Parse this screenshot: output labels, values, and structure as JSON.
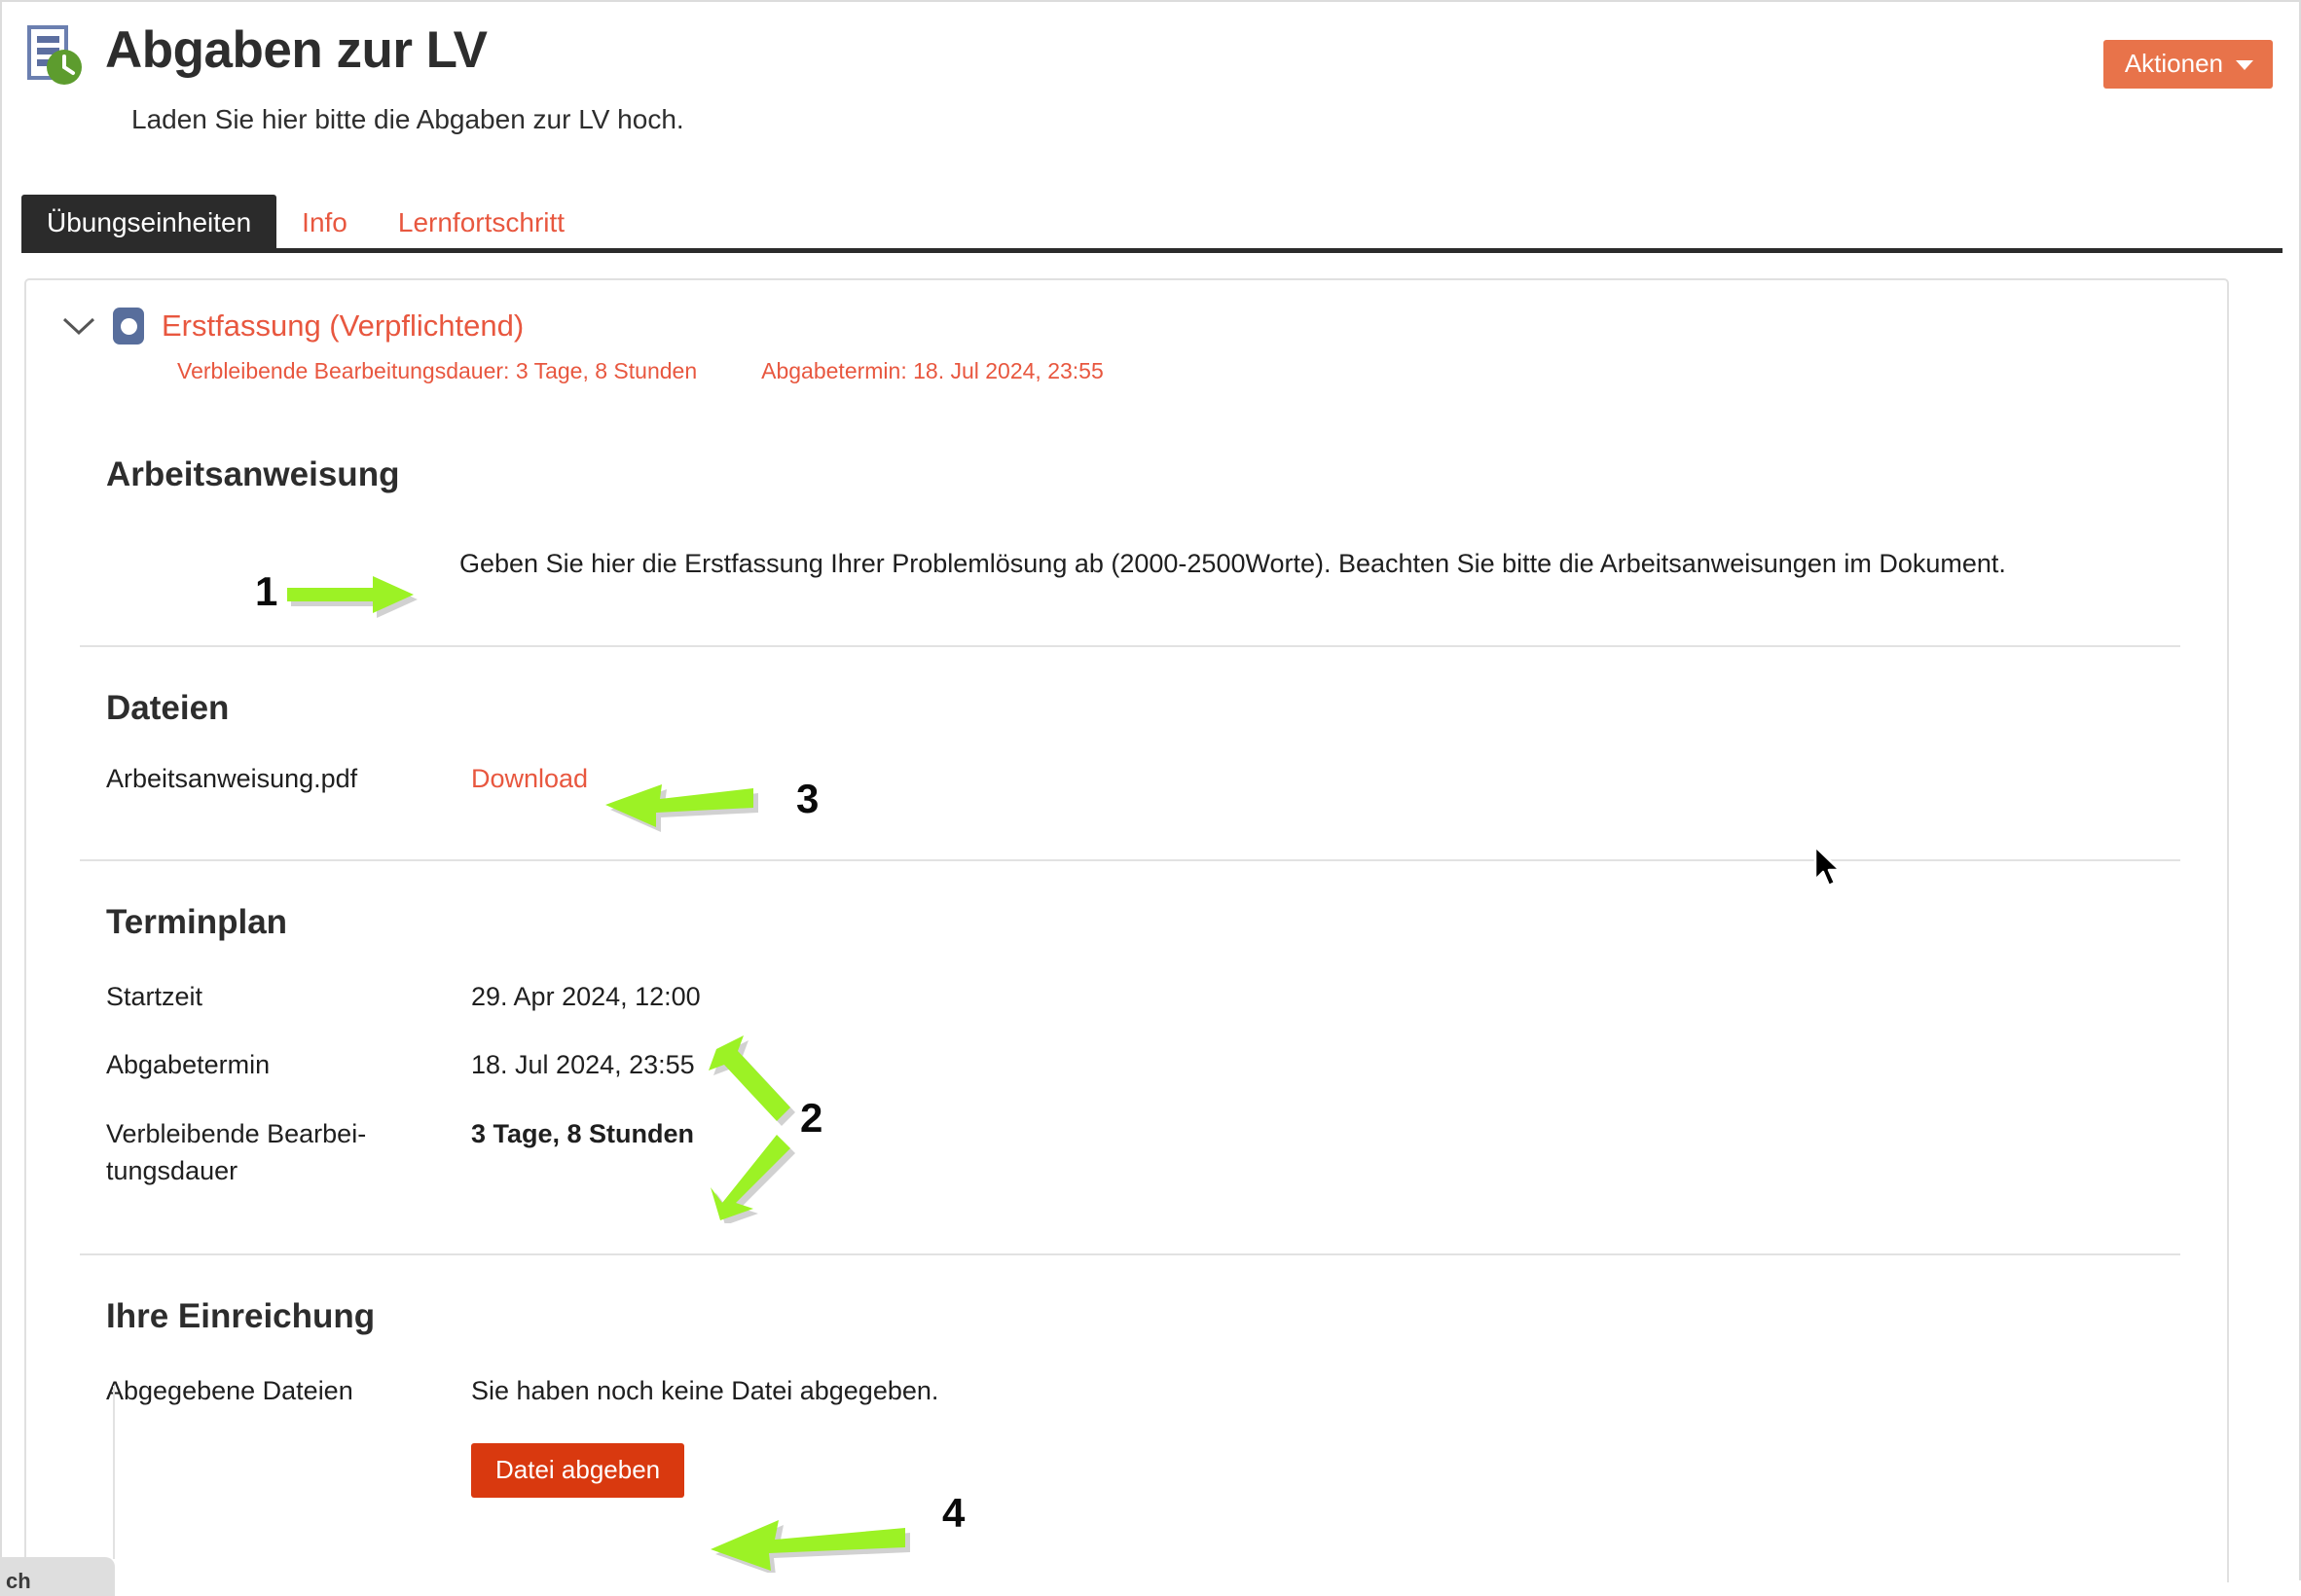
{
  "header": {
    "icon": "document-clock-icon",
    "title": "Abgaben zur LV",
    "subtitle": "Laden Sie hier bitte die Abgaben zur LV hoch.",
    "actions_label": "Aktionen",
    "actions_caret": "chevron-down-icon"
  },
  "tabs": [
    {
      "label": "Übungseinheiten",
      "active": true
    },
    {
      "label": "Info",
      "active": false
    },
    {
      "label": "Lernfortschritt",
      "active": false
    }
  ],
  "unit": {
    "chevron": "chevron-down-icon",
    "status_icon": "assignment-status-icon",
    "title": "Erstfassung (Verpflichtend)",
    "meta_remaining": "Verbleibende Bearbeitungsdauer: 3 Tage, 8 Stunden",
    "meta_deadline": "Abgabetermin: 18. Jul 2024, 23:55"
  },
  "instruction": {
    "heading": "Arbeitsanweisung",
    "text": "Geben Sie hier die Erstfassung Ihrer Problemlösung ab (2000-2500Worte). Beachten Sie bitte die Arbeitsanweisungen im Dokument."
  },
  "files": {
    "heading": "Dateien",
    "rows": [
      {
        "name": "Arbeitsanweisung.pdf",
        "action": "Download"
      }
    ]
  },
  "schedule": {
    "heading": "Terminplan",
    "rows": [
      {
        "key": "Startzeit",
        "value": "29. Apr 2024, 12:00",
        "bold": false
      },
      {
        "key": "Abgabetermin",
        "value": "18. Jul 2024, 23:55",
        "bold": false
      },
      {
        "key": "Verbleibende Bearbei-\ntungsdauer",
        "key_line1": "Verbleibende Bearbei-",
        "key_line2": "tungsdauer",
        "value": "3 Tage, 8 Stunden",
        "bold": true
      }
    ]
  },
  "submission": {
    "heading": "Ihre Einreichung",
    "row_key": "Abgegebene Dateien",
    "row_value": "Sie haben noch keine Datei abgegeben.",
    "button_label": "Datei abgeben"
  },
  "annotations": [
    {
      "number": "1",
      "target": "instruction-text"
    },
    {
      "number": "2",
      "target": "schedule-values"
    },
    {
      "number": "3",
      "target": "download-link"
    },
    {
      "number": "4",
      "target": "submit-button"
    }
  ],
  "bottom_chip": {
    "label": "ch"
  },
  "colors": {
    "accent_orange": "#E8573F",
    "actions_orange": "#E8734A",
    "submit_red": "#D9390F",
    "tab_active_bg": "#2b2b2b",
    "annotation_green": "#9CF225",
    "unit_icon_blue": "#586e9c",
    "icon_green": "#5D9C2E",
    "icon_blue": "#6B7FB0"
  }
}
